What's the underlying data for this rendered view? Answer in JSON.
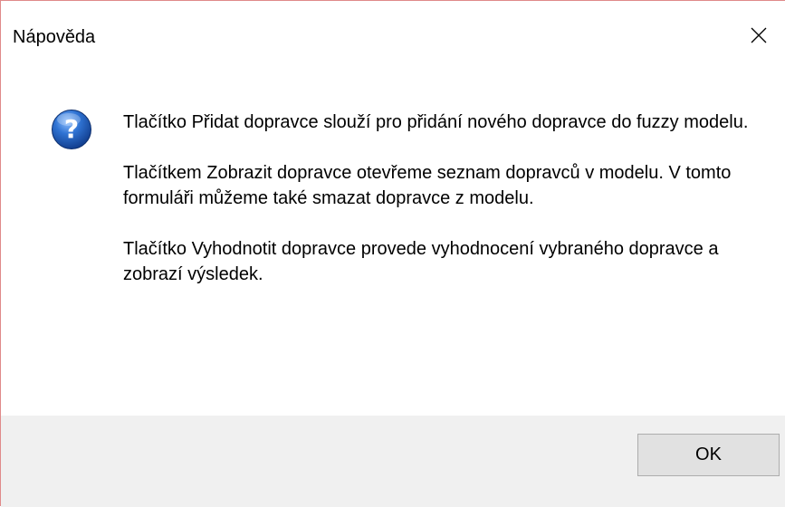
{
  "window": {
    "title": "Nápověda",
    "close_icon": "close-icon"
  },
  "message": {
    "icon": "question-icon",
    "icon_color": "#1f5fb5",
    "paragraphs": [
      "Tlačítko Přidat dopravce slouží pro přidání nového dopravce do fuzzy modelu.",
      "Tlačítkem Zobrazit dopravce otevřeme seznam dopravců v modelu. V tomto formuláři můžeme také smazat dopravce z modelu.",
      "Tlačítko Vyhodnotit dopravce provede vyhodnocení vybraného dopravce a zobrazí výsledek."
    ]
  },
  "buttons": {
    "ok_label": "OK"
  }
}
